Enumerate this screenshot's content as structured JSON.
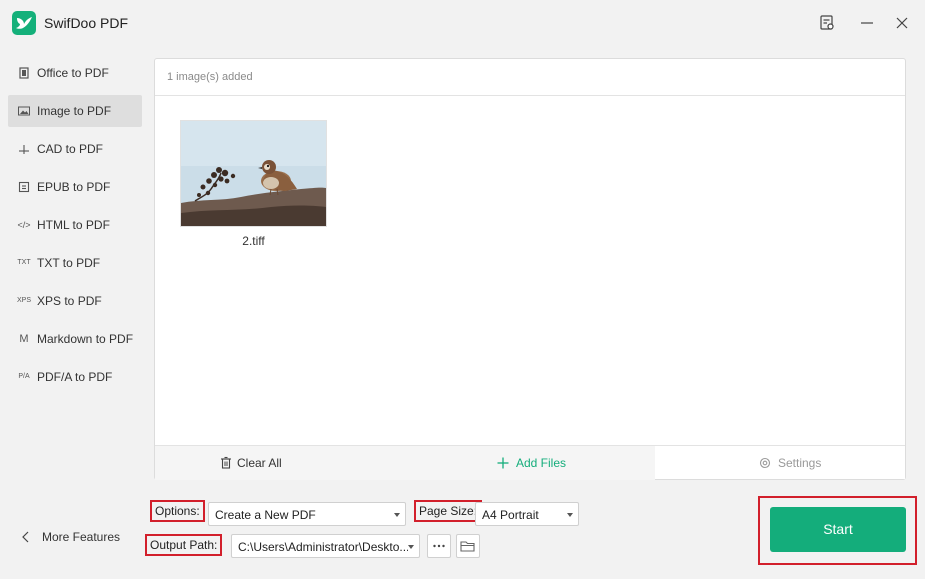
{
  "app": {
    "title": "SwifDoo PDF",
    "brand_color": "#14ad7b"
  },
  "window_controls": [
    {
      "name": "feedback-icon"
    },
    {
      "name": "minimize-icon"
    },
    {
      "name": "close-icon"
    }
  ],
  "sidebar": {
    "items": [
      {
        "label": "Office to PDF",
        "icon": "office-icon",
        "active": false
      },
      {
        "label": "Image to PDF",
        "icon": "image-icon",
        "active": true
      },
      {
        "label": "CAD to PDF",
        "icon": "cad-icon",
        "active": false
      },
      {
        "label": "EPUB to PDF",
        "icon": "epub-icon",
        "active": false
      },
      {
        "label": "HTML to PDF",
        "icon": "html-icon",
        "active": false
      },
      {
        "label": "TXT to PDF",
        "icon": "txt-icon",
        "active": false
      },
      {
        "label": "XPS to PDF",
        "icon": "xps-icon",
        "active": false
      },
      {
        "label": "Markdown to PDF",
        "icon": "markdown-icon",
        "active": false
      },
      {
        "label": "PDF/A to PDF",
        "icon": "pdfa-icon",
        "active": false
      }
    ],
    "more_features": "More Features"
  },
  "file_panel": {
    "count_text": "1 image(s) added",
    "files": [
      {
        "name": "2.tiff"
      }
    ],
    "clear_all": "Clear All",
    "add_files": "Add Files",
    "settings": "Settings"
  },
  "options": {
    "options_label": "Options:",
    "options_value": "Create a New PDF",
    "page_size_label": "Page Size:",
    "page_size_value": "A4 Portrait",
    "output_path_label": "Output Path:",
    "output_path_value": "C:\\Users\\Administrator\\Deskto..."
  },
  "start_label": "Start"
}
